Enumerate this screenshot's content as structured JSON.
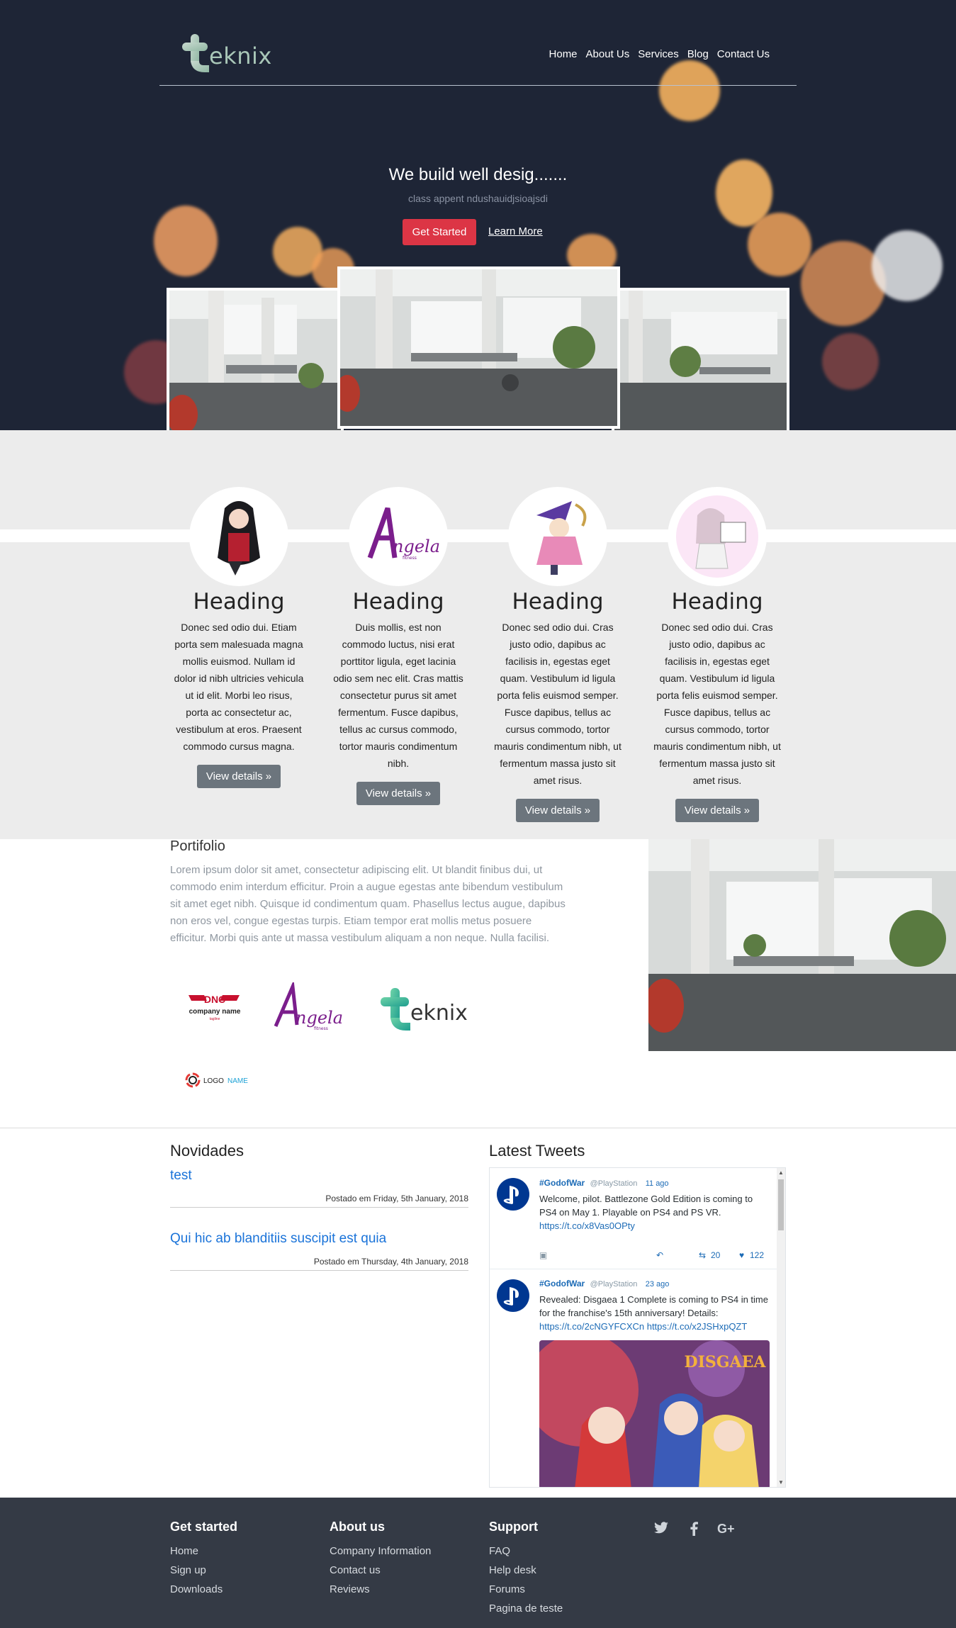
{
  "brand": {
    "logo_text": "eknix"
  },
  "nav": {
    "items": [
      "Home",
      "About Us",
      "Services",
      "Blog",
      "Contact Us"
    ]
  },
  "hero": {
    "title": "We build well desig.......",
    "subtitle": "class appent ndushauidjsioajsdi",
    "primary_button": "Get Started",
    "secondary_link": "Learn More"
  },
  "features": [
    {
      "heading": "Heading",
      "text": "Donec sed odio dui. Etiam porta sem malesuada magna mollis euismod. Nullam id dolor id nibh ultricies vehicula ut id elit. Morbi leo risus, porta ac consectetur ac, vestibulum at eros. Praesent commodo cursus magna.",
      "button": "View details »"
    },
    {
      "heading": "Heading",
      "text": "Duis mollis, est non commodo luctus, nisi erat porttitor ligula, eget lacinia odio sem nec elit. Cras mattis consectetur purus sit amet fermentum. Fusce dapibus, tellus ac cursus commodo, tortor mauris condimentum nibh.",
      "button": "View details »"
    },
    {
      "heading": "Heading",
      "text": "Donec sed odio dui. Cras justo odio, dapibus ac facilisis in, egestas eget quam. Vestibulum id ligula porta felis euismod semper. Fusce dapibus, tellus ac cursus commodo, tortor mauris condimentum nibh, ut fermentum massa justo sit amet risus.",
      "button": "View details »"
    },
    {
      "heading": "Heading",
      "text": "Donec sed odio dui. Cras justo odio, dapibus ac facilisis in, egestas eget quam. Vestibulum id ligula porta felis euismod semper. Fusce dapibus, tellus ac cursus commodo, tortor mauris condimentum nibh, ut fermentum massa justo sit amet risus.",
      "button": "View details »"
    }
  ],
  "portfolio": {
    "title": "Portifolio",
    "text": "Lorem ipsum dolor sit amet, consectetur adipiscing elit. Ut blandit finibus dui, ut commodo enim interdum efficitur. Proin a augue egestas ante bibendum vestibulum sit amet eget nibh. Quisque id condimentum quam. Phasellus lectus augue, dapibus non eros vel, congue egestas turpis. Etiam tempor erat mollis metus posuere efficitur. Morbi quis ante ut massa vestibulum aliquam a non neque. Nulla facilisi.",
    "logos": {
      "company_name": "company name",
      "company_tagline": "tagline",
      "angela": "ngela",
      "angela_sub": "fitness",
      "teknix": "eknix",
      "logo_name_1": "LOGO",
      "logo_name_2": "NAME"
    }
  },
  "news": {
    "title": "Novidades",
    "items": [
      {
        "title": "test",
        "date": "Postado em Friday, 5th January, 2018"
      },
      {
        "title": "Qui hic ab blanditiis suscipit est quia",
        "date": "Postado em Thursday, 4th January, 2018"
      }
    ]
  },
  "tweets": {
    "title": "Latest Tweets",
    "items": [
      {
        "user": "#GodofWar",
        "handle": "@PlayStation",
        "time": "11 ago",
        "text": "Welcome, pilot. Battlezone Gold Edition is coming to PS4 on May 1. Playable on PS4 and PS VR.",
        "link": "https://t.co/x8Vas0OPty",
        "retweets": "20",
        "likes": "122"
      },
      {
        "user": "#GodofWar",
        "handle": "@PlayStation",
        "time": "23 ago",
        "text": "Revealed: Disgaea 1 Complete is coming to PS4 in time for the franchise's 15th anniversary! Details:",
        "link": "https://t.co/2cNGYFCXCn https://t.co/x2JSHxpQZT",
        "image_title": "DISGAEA"
      }
    ]
  },
  "footer": {
    "col1": {
      "title": "Get started",
      "links": [
        "Home",
        "Sign up",
        "Downloads"
      ]
    },
    "col2": {
      "title": "About us",
      "links": [
        "Company Information",
        "Contact us",
        "Reviews"
      ]
    },
    "col3": {
      "title": "Support",
      "links": [
        "FAQ",
        "Help desk",
        "Forums",
        "Pagina de teste"
      ]
    }
  },
  "colors": {
    "hero_bg": "#1e2536",
    "primary": "#dc3545",
    "secondary": "#6c757d",
    "footer_bg": "#343a45",
    "link": "#1a73d9"
  }
}
